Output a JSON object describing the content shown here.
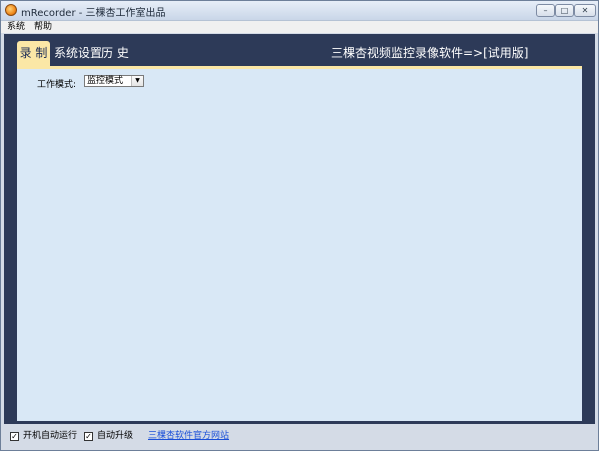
{
  "window": {
    "title": "mRecorder - 三棵杏工作室出品",
    "controls": {
      "minimize": "–",
      "maximize": "□",
      "close": "✕"
    }
  },
  "menu": {
    "items": [
      "系统",
      "帮助"
    ]
  },
  "tabs": [
    {
      "label": "录 制",
      "selected": true
    },
    {
      "label": "系统设置",
      "selected": false
    },
    {
      "label": "历 史",
      "selected": false
    }
  ],
  "header": {
    "product_title": "三棵杏视频监控录像软件=>[试用版]"
  },
  "record_panel": {
    "work_mode_label": "工作模式:",
    "work_mode_value": "监控模式",
    "dropdown_arrow": "▼"
  },
  "footer": {
    "autostart_label": "开机自动运行",
    "autostart_checked": "✓",
    "autoupdate_label": "自动升级",
    "autoupdate_checked": "✓",
    "website_link": "三棵杏软件官方网站"
  },
  "colors": {
    "client_bg": "#2d3a58",
    "tab_selected_bg": "#fbe7a6",
    "panel_bg": "#d9e8f6",
    "link": "#1a4fd8"
  },
  "icons": {
    "app": "app-logo-icon",
    "dropdown": "chevron-down-icon",
    "check": "checkmark-icon"
  }
}
